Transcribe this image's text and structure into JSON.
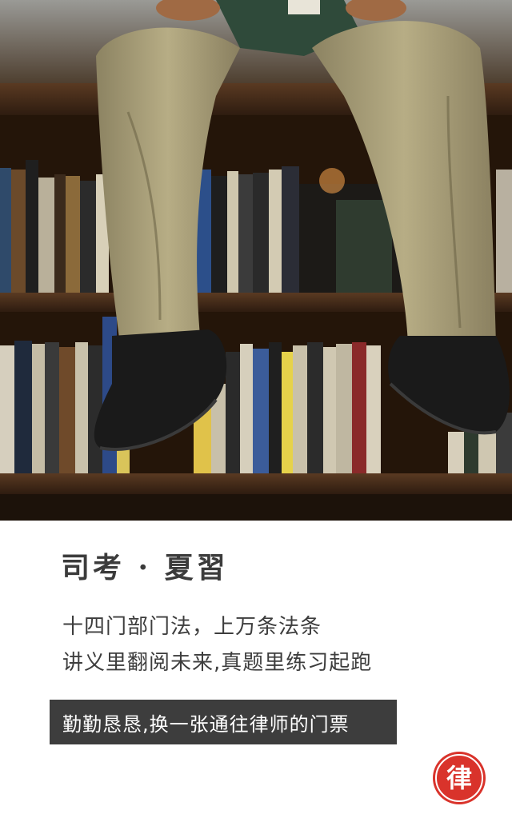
{
  "hero": {
    "icon": "library-reading-photo"
  },
  "title": "司考 · 夏習",
  "lines": [
    "十四门部门法，上万条法条",
    "讲义里翻阅未来,真题里练习起跑"
  ],
  "banner": "勤勤恳恳,换一张通往律师的门票",
  "seal": {
    "char": "律",
    "color": "#d9332b"
  }
}
